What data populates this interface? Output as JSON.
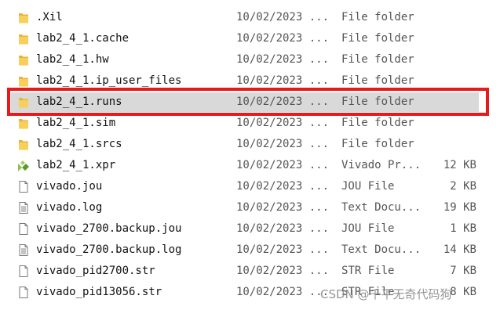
{
  "files": [
    {
      "name": ".Xil",
      "date": "10/02/2023 ...",
      "type": "File folder",
      "size": "",
      "icon": "folder-icon"
    },
    {
      "name": "lab2_4_1.cache",
      "date": "10/02/2023 ...",
      "type": "File folder",
      "size": "",
      "icon": "folder-icon"
    },
    {
      "name": "lab2_4_1.hw",
      "date": "10/02/2023 ...",
      "type": "File folder",
      "size": "",
      "icon": "folder-icon"
    },
    {
      "name": "lab2_4_1.ip_user_files",
      "date": "10/02/2023 ...",
      "type": "File folder",
      "size": "",
      "icon": "folder-icon"
    },
    {
      "name": "lab2_4_1.runs",
      "date": "10/02/2023 ...",
      "type": "File folder",
      "size": "",
      "icon": "folder-icon",
      "selected": true
    },
    {
      "name": "lab2_4_1.sim",
      "date": "10/02/2023 ...",
      "type": "File folder",
      "size": "",
      "icon": "folder-icon"
    },
    {
      "name": "lab2_4_1.srcs",
      "date": "10/02/2023 ...",
      "type": "File folder",
      "size": "",
      "icon": "folder-icon"
    },
    {
      "name": "lab2_4_1.xpr",
      "date": "10/02/2023 ...",
      "type": "Vivado Pr...",
      "size": "12 KB",
      "icon": "vivado-project-icon"
    },
    {
      "name": "vivado.jou",
      "date": "10/02/2023 ...",
      "type": "JOU File",
      "size": "2 KB",
      "icon": "file-icon"
    },
    {
      "name": "vivado.log",
      "date": "10/02/2023 ...",
      "type": "Text Docu...",
      "size": "19 KB",
      "icon": "text-document-icon"
    },
    {
      "name": "vivado_2700.backup.jou",
      "date": "10/02/2023 ...",
      "type": "JOU File",
      "size": "1 KB",
      "icon": "file-icon"
    },
    {
      "name": "vivado_2700.backup.log",
      "date": "10/02/2023 ...",
      "type": "Text Docu...",
      "size": "14 KB",
      "icon": "text-document-icon"
    },
    {
      "name": "vivado_pid2700.str",
      "date": "10/02/2023 ...",
      "type": "STR File",
      "size": "7 KB",
      "icon": "file-icon"
    },
    {
      "name": "vivado_pid13056.str",
      "date": "10/02/2023 ...",
      "type": "STR File",
      "size": "8 KB",
      "icon": "file-icon"
    }
  ],
  "watermark": "CSDN @千平无奇代码狗",
  "colors": {
    "highlight_border": "#e8191a",
    "selection_bg": "#d9d9d9",
    "folder_yellow": "#f5c242"
  }
}
